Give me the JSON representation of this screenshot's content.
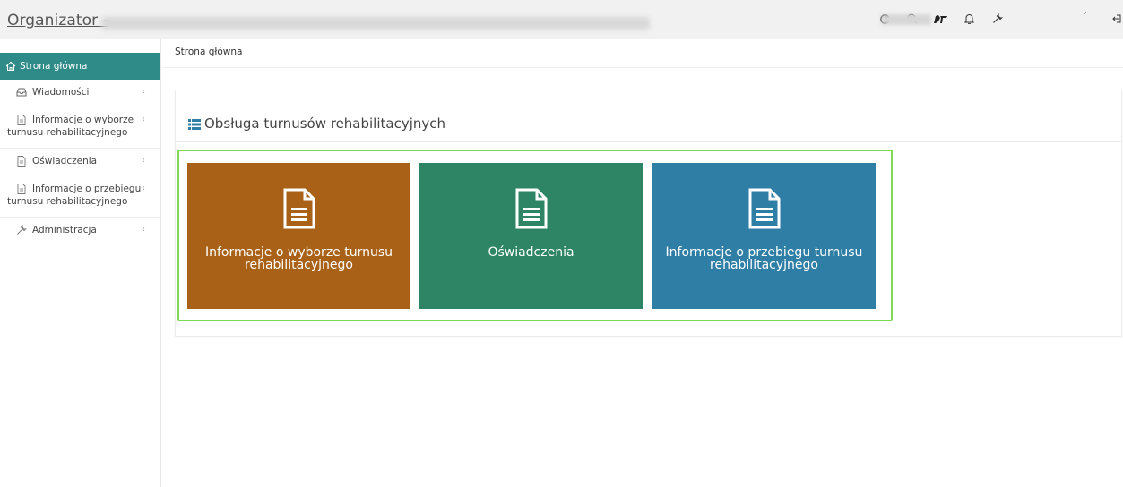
{
  "header": {
    "app_title": "Organizator -",
    "icons": [
      "contrast-icon",
      "zoom-icon",
      "sign-language-icon",
      "bell-icon",
      "wrench-icon",
      "logout-icon"
    ],
    "user_chevron": "˅"
  },
  "sidebar": {
    "items": [
      {
        "label": "Strona główna",
        "icon": "home-icon",
        "active": true
      },
      {
        "label": "Wiadomości",
        "icon": "inbox-icon"
      },
      {
        "label_line1": "Informacje o wyborze",
        "label_line2": "turnusu rehabilitacyjnego",
        "icon": "document-icon"
      },
      {
        "label": "Oświadczenia",
        "icon": "document-icon"
      },
      {
        "label_line1": "Informacje o przebiegu",
        "label_line2": "turnusu rehabilitacyjnego",
        "icon": "document-icon"
      },
      {
        "label": "Administracja",
        "icon": "wrench-icon"
      }
    ],
    "chevron": "‹"
  },
  "breadcrumb": "Strona główna",
  "panel": {
    "title": "Obsługa turnusów rehabilitacyjnych",
    "tiles": [
      {
        "label_line1": "Informacje o wyborze turnusu",
        "label_line2": "rehabilitacyjnego",
        "color": "#a86116"
      },
      {
        "label_line1": "Oświadczenia",
        "label_line2": "",
        "color": "#2e8566"
      },
      {
        "label_line1": "Informacje o przebiegu turnusu",
        "label_line2": "rehabilitacyjnego",
        "color": "#2f7ea5"
      }
    ]
  },
  "colors": {
    "accent": "#2e8b88",
    "highlight_border": "#7ed957"
  }
}
